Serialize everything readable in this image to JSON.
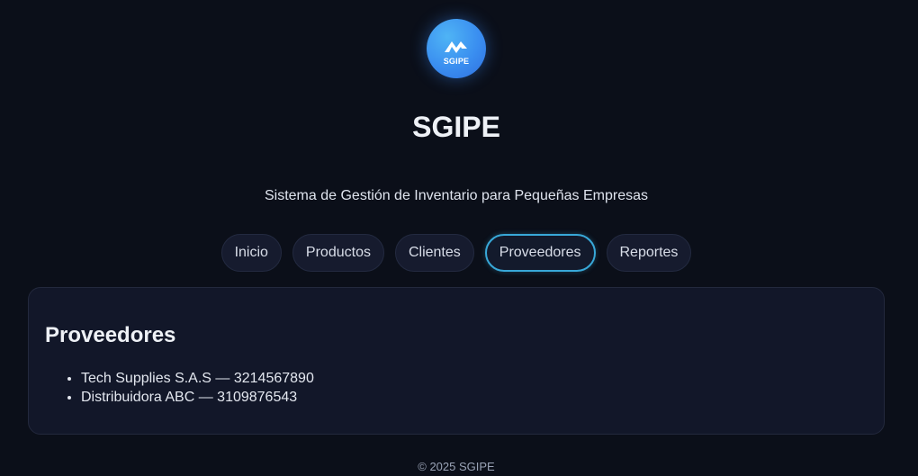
{
  "brand": {
    "logo_text": "SGIPE",
    "title": "SGIPE",
    "subtitle": "Sistema de Gestión de Inventario para Pequeñas Empresas"
  },
  "nav": {
    "tabs": [
      {
        "label": "Inicio",
        "active": false
      },
      {
        "label": "Productos",
        "active": false
      },
      {
        "label": "Clientes",
        "active": false
      },
      {
        "label": "Proveedores",
        "active": true
      },
      {
        "label": "Reportes",
        "active": false
      }
    ]
  },
  "section": {
    "title": "Proveedores",
    "items": [
      "Tech Supplies S.A.S — 3214567890",
      "Distribuidora ABC — 3109876543"
    ]
  },
  "footer": {
    "text": "© 2025 SGIPE"
  },
  "colors": {
    "background": "#0b0f19",
    "accent": "#38a8d8",
    "logo_blue": "#3a8ef0"
  },
  "icons": {
    "logo": "sgipe-logo-icon"
  }
}
